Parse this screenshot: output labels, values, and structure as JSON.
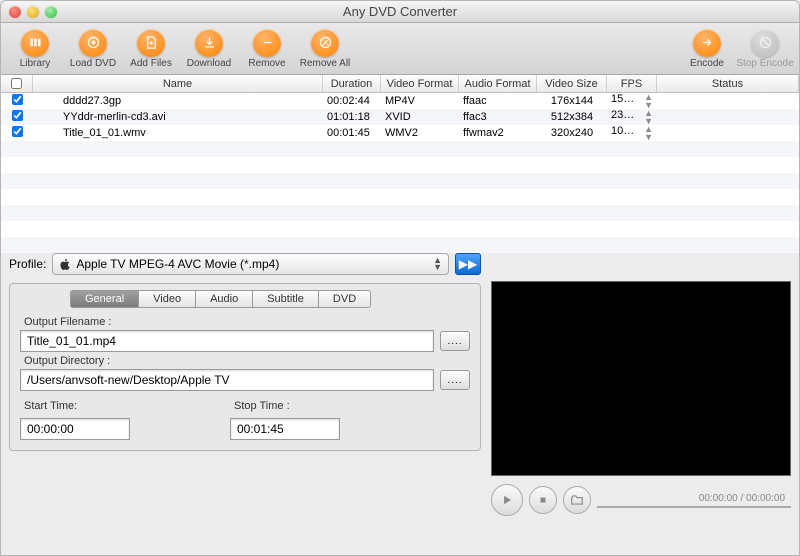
{
  "window": {
    "title": "Any DVD Converter"
  },
  "toolbar": {
    "library": "Library",
    "load_dvd": "Load DVD",
    "add_files": "Add Files",
    "download": "Download",
    "remove": "Remove",
    "remove_all": "Remove All",
    "encode": "Encode",
    "stop_encode": "Stop Encode"
  },
  "columns": {
    "name": "Name",
    "duration": "Duration",
    "video_format": "Video Format",
    "audio_format": "Audio Format",
    "video_size": "Video Size",
    "fps": "FPS",
    "status": "Status"
  },
  "files": [
    {
      "checked": true,
      "name": "dddd27.3gp",
      "duration": "00:02:44",
      "vf": "MP4V",
      "af": "ffaac",
      "vs": "176x144",
      "fps": "15…"
    },
    {
      "checked": true,
      "name": "YYddr-merlin-cd3.avi",
      "duration": "01:01:18",
      "vf": "XVID",
      "af": "ffac3",
      "vs": "512x384",
      "fps": "23…"
    },
    {
      "checked": true,
      "name": "Title_01_01.wmv",
      "duration": "00:01:45",
      "vf": "WMV2",
      "af": "ffwmav2",
      "vs": "320x240",
      "fps": "10…"
    }
  ],
  "profile": {
    "label": "Profile:",
    "selected": "Apple TV MPEG-4 AVC Movie (*.mp4)"
  },
  "tabs": {
    "general": "General",
    "video": "Video",
    "audio": "Audio",
    "subtitle": "Subtitle",
    "dvd": "DVD"
  },
  "settings": {
    "output_filename_label": "Output Filename :",
    "output_filename": "Title_01_01.mp4",
    "output_directory_label": "Output Directory :",
    "output_directory": "/Users/anvsoft-new/Desktop/Apple TV",
    "start_time_label": "Start Time:",
    "start_time": "00:00:00",
    "stop_time_label": "Stop Time :",
    "stop_time": "00:01:45",
    "browse": "...."
  },
  "player": {
    "time": "00:00:00 / 00:00:00"
  }
}
